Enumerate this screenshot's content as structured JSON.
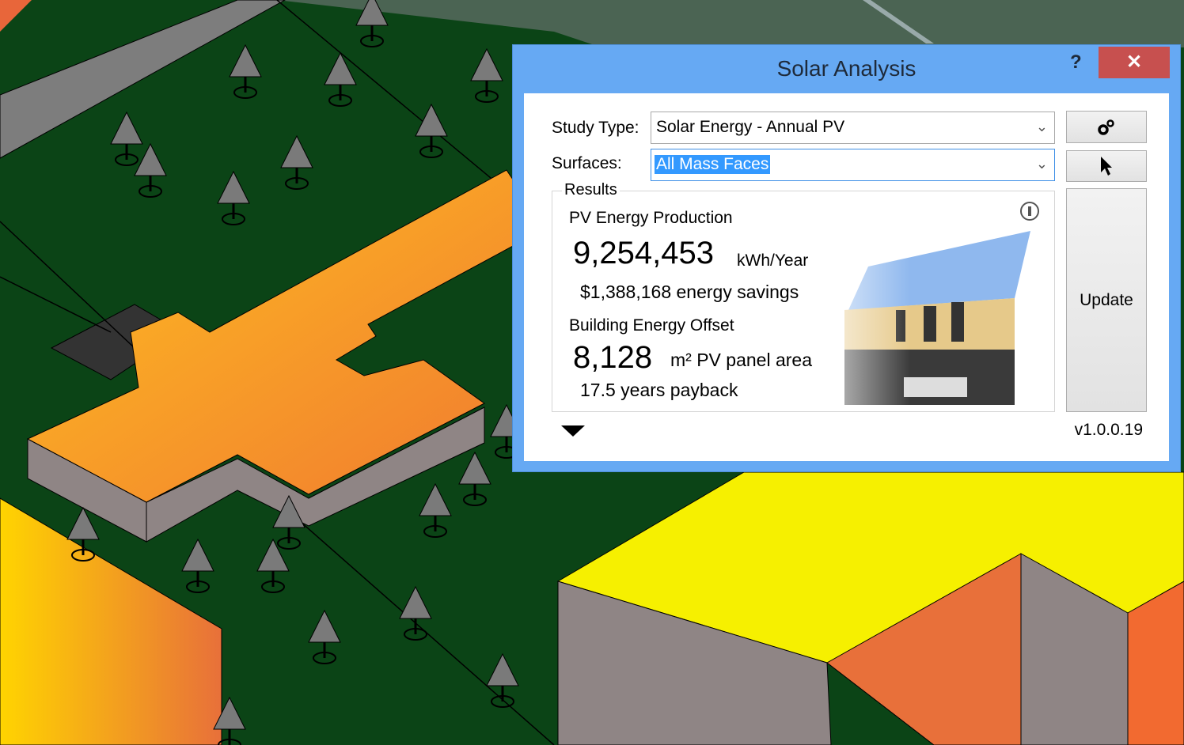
{
  "dialog": {
    "title": "Solar Analysis",
    "help_label": "?",
    "close_label": "✕",
    "study_type_label": "Study Type:",
    "study_type_value": "Solar Energy - Annual PV",
    "surfaces_label": "Surfaces:",
    "surfaces_value": "All Mass Faces",
    "settings_icon": "gears-icon",
    "pick_icon": "cursor-arrow-icon",
    "update_label": "Update",
    "version": "v1.0.0.19",
    "results": {
      "group_label": "Results",
      "pv_heading": "PV Energy Production",
      "pv_value": "9,254,453",
      "pv_unit": "kWh/Year",
      "savings": "$1,388,168 energy savings",
      "offset_heading": "Building Energy Offset",
      "area_value": "8,128",
      "area_unit": "m² PV panel area",
      "payback": "17.5 years payback"
    }
  },
  "colors": {
    "titlebar": "#66a9f3",
    "close": "#c7504f",
    "selection": "#3399ff",
    "ground": "#0b4416"
  }
}
